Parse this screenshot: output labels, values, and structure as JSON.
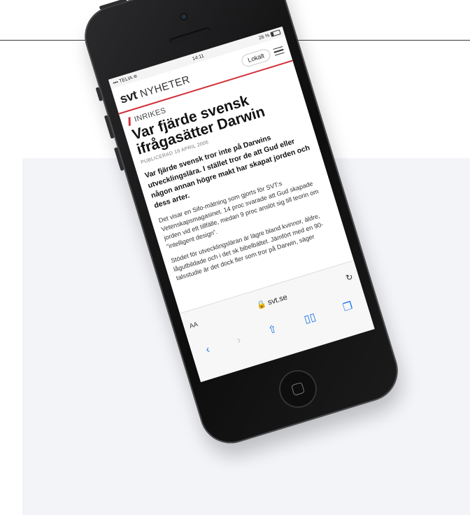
{
  "status": {
    "carrier": "TELIA",
    "time": "14:11",
    "battery": "26 %"
  },
  "header": {
    "logo_svt": "svt",
    "logo_section": "NYHETER",
    "lokalt_label": "Lokalt"
  },
  "article": {
    "section": "INRIKES",
    "headline": "Var fjärde svensk ifrågasätter Darwin",
    "published": "PUBLICERAD 19 APRIL 2006",
    "lead": "Var fjärde svensk tror inte på Darwins utvecklingslära. I stället tror de att Gud eller någon annan högre makt har skapat jorden och dess arter.",
    "paragraphs": [
      "Det visar en Sifo-mätning som gjorts för SVT:s Vetenskapsmagasinet. 14 proc svarade att Gud skapade jorden vid ett tillfälle, medan 9 proc anslöt sig till teorin om ”intelligent design”.",
      "Stödet för utvecklingsläran är lägre bland kvinnor, äldre, lågutbildade och i det sk bibelbältet. Jämfört med en 90-talsstudie är det dock fler som tror på Darwin, säger"
    ]
  },
  "browser": {
    "aa_label": "AA",
    "url": "svt.se",
    "icons": [
      "reload-icon",
      "back-icon",
      "forward-icon",
      "share-icon",
      "bookmarks-icon",
      "tabs-icon",
      "lock-icon"
    ]
  },
  "colors": {
    "accent_red": "#d32f3a",
    "link_blue": "#1a73e8",
    "panel_bg": "#f3f4f8"
  }
}
